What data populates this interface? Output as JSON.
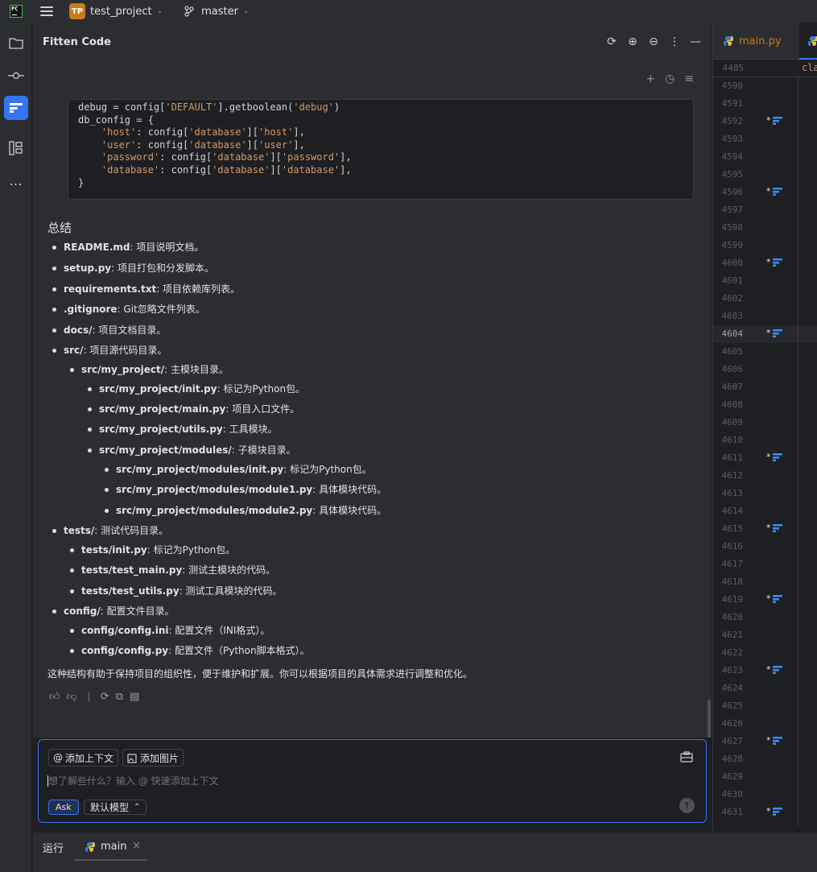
{
  "titlebar": {
    "project_badge": "TP",
    "project_name": "test_project",
    "branch": "master"
  },
  "panel": {
    "title": "Fitten Code"
  },
  "code_lines": [
    "debug = config['DEFAULT'].getboolean('debug')",
    "db_config = {",
    "    'host': config['database']['host'],",
    "    'user': config['database']['user'],",
    "    'password': config['database']['password'],",
    "    'database': config['database']['database'],",
    "}"
  ],
  "summary": {
    "heading": "总结",
    "items": [
      {
        "level": 0,
        "name": "README.md",
        "desc": ": 项目说明文档。"
      },
      {
        "level": 0,
        "name": "setup.py",
        "desc": ": 项目打包和分发脚本。"
      },
      {
        "level": 0,
        "name": "requirements.txt",
        "desc": ": 项目依赖库列表。"
      },
      {
        "level": 0,
        "name": ".gitignore",
        "desc": ": Git忽略文件列表。"
      },
      {
        "level": 0,
        "name": "docs/",
        "desc": ": 项目文档目录。"
      },
      {
        "level": 0,
        "name": "src/",
        "desc": ": 项目源代码目录。"
      },
      {
        "level": 1,
        "name": "src/my_project/",
        "desc": ": 主模块目录。"
      },
      {
        "level": 2,
        "name": "src/my_project/init.py",
        "desc": ": 标记为Python包。"
      },
      {
        "level": 2,
        "name": "src/my_project/main.py",
        "desc": ": 项目入口文件。"
      },
      {
        "level": 2,
        "name": "src/my_project/utils.py",
        "desc": ": 工具模块。"
      },
      {
        "level": 2,
        "name": "src/my_project/modules/",
        "desc": ": 子模块目录。"
      },
      {
        "level": 3,
        "name": "src/my_project/modules/init.py",
        "desc": ": 标记为Python包。"
      },
      {
        "level": 3,
        "name": "src/my_project/modules/module1.py",
        "desc": ": 具体模块代码。"
      },
      {
        "level": 3,
        "name": "src/my_project/modules/module2.py",
        "desc": ": 具体模块代码。"
      },
      {
        "level": 0,
        "name": "tests/",
        "desc": ": 测试代码目录。"
      },
      {
        "level": 1,
        "name": "tests/init.py",
        "desc": ": 标记为Python包。"
      },
      {
        "level": 1,
        "name": "tests/test_main.py",
        "desc": ": 测试主模块的代码。"
      },
      {
        "level": 1,
        "name": "tests/test_utils.py",
        "desc": ": 测试工具模块的代码。"
      },
      {
        "level": 0,
        "name": "config/",
        "desc": ": 配置文件目录。"
      },
      {
        "level": 1,
        "name": "config/config.ini",
        "desc": ": 配置文件（INI格式）。"
      },
      {
        "level": 1,
        "name": "config/config.py",
        "desc": ": 配置文件（Python脚本格式）。"
      }
    ],
    "conclusion": "这种结构有助于保持项目的组织性，便于维护和扩展。你可以根据项目的具体需求进行调整和优化。"
  },
  "input": {
    "add_context": "添加上下文",
    "add_image": "添加图片",
    "placeholder": "想了解些什么？输入 @ 快速添加上下文",
    "ask": "Ask",
    "model": "默认模型"
  },
  "editor": {
    "tab1": "main.py",
    "sticky_line_no": "4485",
    "sticky_code": "cla",
    "current_line": "4604",
    "lines": [
      "4590",
      "4591",
      "4592",
      "4593",
      "4594",
      "4595",
      "4596",
      "4597",
      "4598",
      "4599",
      "4600",
      "4601",
      "4602",
      "4603",
      "4604",
      "4605",
      "4606",
      "4607",
      "4608",
      "4609",
      "4610",
      "4611",
      "4612",
      "4613",
      "4614",
      "4615",
      "4616",
      "4617",
      "4618",
      "4619",
      "4620",
      "4621",
      "4622",
      "4623",
      "4624",
      "4625",
      "4626",
      "4627",
      "4628",
      "4629",
      "4630",
      "4631"
    ],
    "marked_lines": [
      "4592",
      "4596",
      "4600",
      "4604",
      "4611",
      "4615",
      "4619",
      "4623",
      "4627",
      "4631"
    ]
  },
  "bottom": {
    "run_label": "运行",
    "run_tab": "main"
  }
}
